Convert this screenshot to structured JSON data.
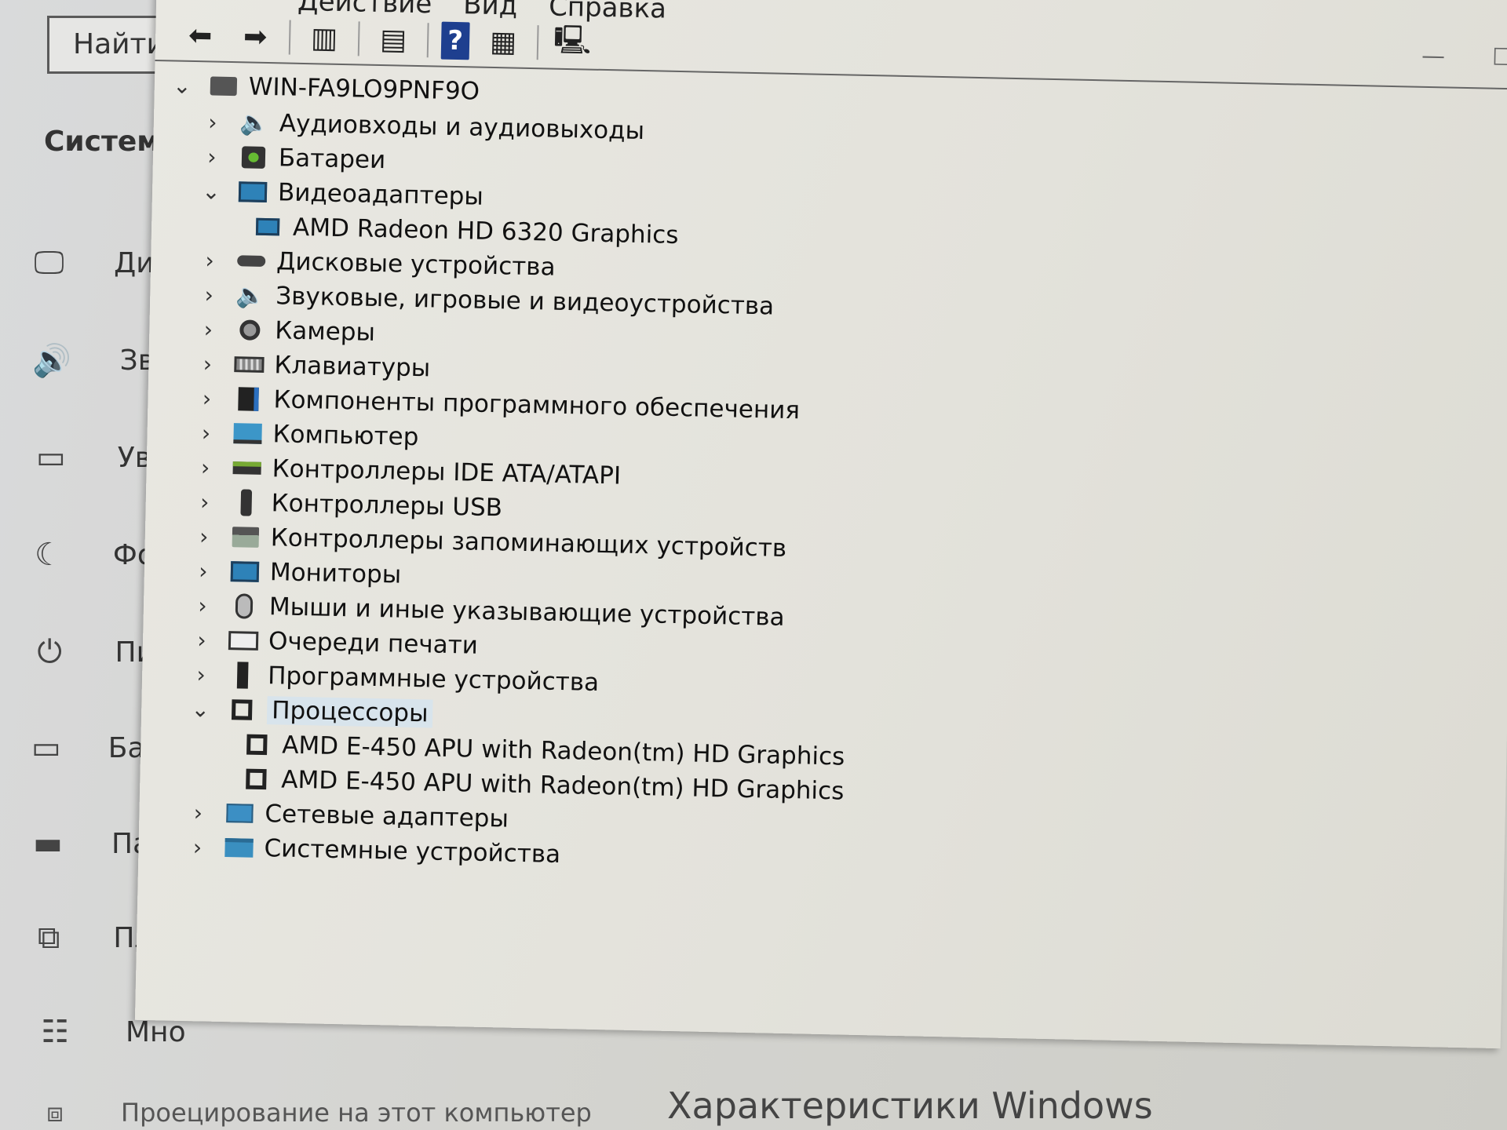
{
  "settings": {
    "search_placeholder": "Найти п",
    "section_title": "Система",
    "nav_items": [
      {
        "icon": "display-icon",
        "label": "Дисп"
      },
      {
        "icon": "sound-icon",
        "label": "Звук"
      },
      {
        "icon": "notifications-icon",
        "label": "Увед"
      },
      {
        "icon": "focus-assist-icon",
        "label": "Фоку"
      },
      {
        "icon": "power-icon",
        "label": "Пита"
      },
      {
        "icon": "battery-icon",
        "label": "Батар"
      },
      {
        "icon": "storage-icon",
        "label": "Памя"
      },
      {
        "icon": "tablet-mode-icon",
        "label": "План"
      },
      {
        "icon": "multitasking-icon",
        "label": "Мно"
      }
    ],
    "footer_link": "Проецирование на этот компьютер",
    "windows_specs_heading": "Характеристики Windows"
  },
  "device_manager": {
    "menu": [
      "Действие",
      "Вид",
      "Справка"
    ],
    "toolbar": [
      {
        "icon": "back-arrow-icon"
      },
      {
        "icon": "forward-arrow-icon"
      },
      {
        "icon": "show-hide-tree-icon"
      },
      {
        "icon": "properties-icon"
      },
      {
        "icon": "help-icon",
        "label": "?"
      },
      {
        "icon": "view-icon"
      },
      {
        "icon": "scan-hardware-icon"
      }
    ],
    "tree": {
      "root": "WIN-FA9LO9PNF9O",
      "categories": [
        {
          "label": "Аудиовходы и аудиовыходы",
          "icon": "audio-io-icon",
          "expanded": false
        },
        {
          "label": "Батареи",
          "icon": "battery-icon",
          "expanded": false
        },
        {
          "label": "Видеоадаптеры",
          "icon": "display-adapter-icon",
          "expanded": true,
          "children": [
            "AMD Radeon HD 6320 Graphics"
          ]
        },
        {
          "label": "Дисковые устройства",
          "icon": "disk-drive-icon",
          "expanded": false
        },
        {
          "label": "Звуковые, игровые и видеоустройства",
          "icon": "sound-device-icon",
          "expanded": false
        },
        {
          "label": "Камеры",
          "icon": "camera-icon",
          "expanded": false
        },
        {
          "label": "Клавиатуры",
          "icon": "keyboard-icon",
          "expanded": false
        },
        {
          "label": "Компоненты программного обеспечения",
          "icon": "software-component-icon",
          "expanded": false
        },
        {
          "label": "Компьютер",
          "icon": "computer-icon",
          "expanded": false
        },
        {
          "label": "Контроллеры IDE ATA/ATAPI",
          "icon": "ide-controller-icon",
          "expanded": false
        },
        {
          "label": "Контроллеры USB",
          "icon": "usb-icon",
          "expanded": false
        },
        {
          "label": "Контроллеры запоминающих устройств",
          "icon": "storage-controller-icon",
          "expanded": false
        },
        {
          "label": "Мониторы",
          "icon": "monitor-icon",
          "expanded": false
        },
        {
          "label": "Мыши и иные указывающие устройства",
          "icon": "mouse-icon",
          "expanded": false
        },
        {
          "label": "Очереди печати",
          "icon": "print-queue-icon",
          "expanded": false
        },
        {
          "label": "Программные устройства",
          "icon": "software-device-icon",
          "expanded": false
        },
        {
          "label": "Процессоры",
          "icon": "processor-icon",
          "expanded": true,
          "selected": true,
          "children": [
            "AMD E-450 APU with Radeon(tm) HD Graphics",
            "AMD E-450 APU with Radeon(tm) HD Graphics"
          ]
        },
        {
          "label": "Сетевые адаптеры",
          "icon": "network-adapter-icon",
          "expanded": false
        },
        {
          "label": "Системные устройства",
          "icon": "system-devices-icon",
          "expanded": false
        }
      ]
    }
  }
}
